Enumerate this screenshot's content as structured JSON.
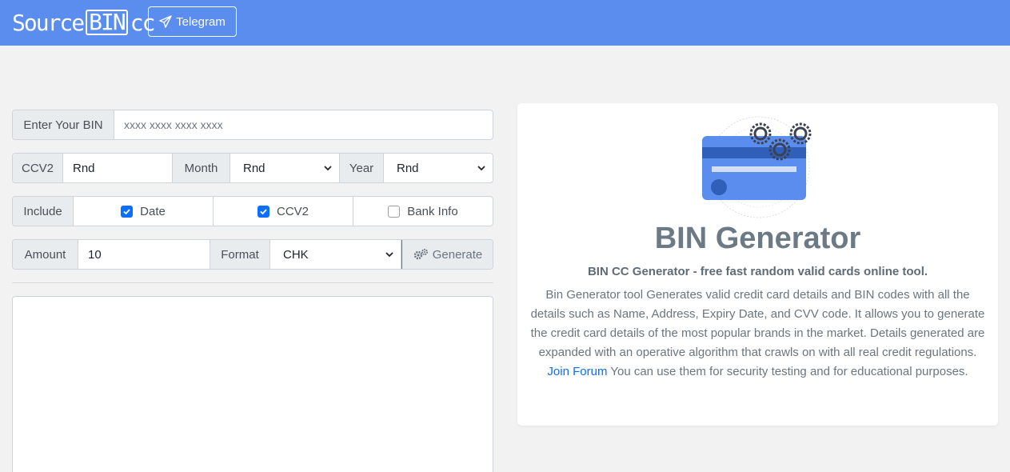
{
  "navbar": {
    "brand_prefix": "Source",
    "brand_boxed": "BIN",
    "brand_suffix": "cc",
    "telegram_label": "Telegram"
  },
  "form": {
    "bin_label": "Enter Your BIN",
    "bin_placeholder": "xxxx xxxx xxxx xxxx",
    "ccv2_label": "CCV2",
    "ccv2_value": "Rnd",
    "month_label": "Month",
    "month_value": "Rnd",
    "year_label": "Year",
    "year_value": "Rnd",
    "include_label": "Include",
    "include_date": {
      "label": "Date",
      "checked": true
    },
    "include_ccv2": {
      "label": "CCV2",
      "checked": true
    },
    "include_bank": {
      "label": "Bank Info",
      "checked": false
    },
    "amount_label": "Amount",
    "amount_value": "10",
    "format_label": "Format",
    "format_value": "CHK",
    "generate_label": "Generate",
    "output_value": ""
  },
  "info": {
    "title": "BIN Generator",
    "subtitle": "BIN CC Generator - free fast random valid cards online tool.",
    "desc_before": "Bin Generator tool Generates valid credit card details and BIN codes with all the details such as Name, Address, Expiry Date, and CVV code. It allows you to generate the credit card details of the most popular brands in the market. Details generated are expanded with an operative algorithm that crawls on with all real credit regulations.",
    "link_label": "Join Forum",
    "desc_after": "You can use them for security testing and for educational purposes."
  },
  "colors": {
    "navbar": "#5a8ded",
    "accent": "#0d6efd",
    "card_illustration": "#5a8ded"
  }
}
